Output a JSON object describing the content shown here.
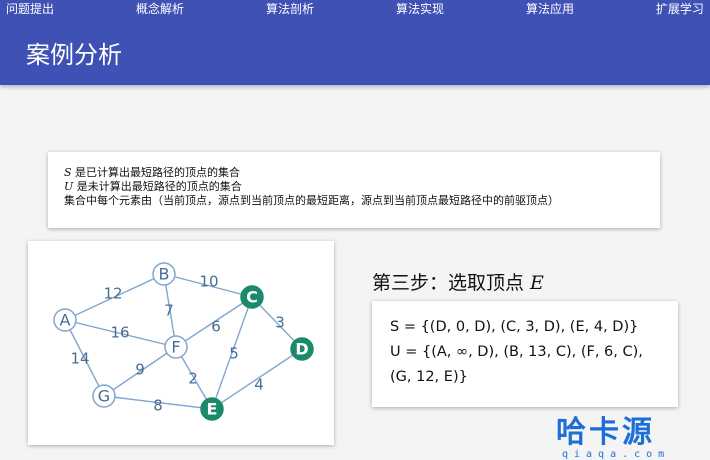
{
  "nav": {
    "items": [
      "问题提出",
      "概念解析",
      "算法剖析",
      "算法实现",
      "算法应用",
      "扩展学习"
    ]
  },
  "header": {
    "title": "案例分析"
  },
  "info": {
    "s_var": "S",
    "s_text": " 是已计算出最短路径的顶点的集合",
    "u_var": "U",
    "u_text": " 是未计算出最短路径的顶点的集合",
    "line3": "集合中每个元素由（当前顶点，源点到当前顶点的最短距离，源点到当前顶点最短路径中的前驱顶点）"
  },
  "step": {
    "title": "第三步：选取顶点 ",
    "vertex": "E"
  },
  "sets": {
    "s_line": "S = {(D, 0, D), (C, 3, D), (E, 4, D)}",
    "u_line": "U = {(A, ∞, D), (B, 13, C), (F, 6, C), (G, 12, E)}"
  },
  "graph": {
    "nodes": [
      {
        "id": "A",
        "selected": false
      },
      {
        "id": "B",
        "selected": false
      },
      {
        "id": "C",
        "selected": true
      },
      {
        "id": "D",
        "selected": true
      },
      {
        "id": "E",
        "selected": true
      },
      {
        "id": "F",
        "selected": false
      },
      {
        "id": "G",
        "selected": false
      }
    ],
    "edges": [
      {
        "from": "A",
        "to": "B",
        "weight": "12"
      },
      {
        "from": "A",
        "to": "F",
        "weight": "16"
      },
      {
        "from": "A",
        "to": "G",
        "weight": "14"
      },
      {
        "from": "B",
        "to": "C",
        "weight": "10"
      },
      {
        "from": "B",
        "to": "F",
        "weight": "7"
      },
      {
        "from": "C",
        "to": "F",
        "weight": "6"
      },
      {
        "from": "C",
        "to": "D",
        "weight": "3"
      },
      {
        "from": "C",
        "to": "E",
        "weight": "5"
      },
      {
        "from": "F",
        "to": "G",
        "weight": "9"
      },
      {
        "from": "F",
        "to": "E",
        "weight": "2"
      },
      {
        "from": "G",
        "to": "E",
        "weight": "8"
      },
      {
        "from": "D",
        "to": "E",
        "weight": "4"
      }
    ],
    "colors": {
      "edge": "#7fa6cf",
      "node_stroke": "#7fa6cf",
      "label": "#4a6c93",
      "selected_fill": "#1a8a6a"
    }
  },
  "watermark": {
    "brand": "哈卡源",
    "url": "qiaqa.com",
    "color": "#1d6fd6"
  }
}
